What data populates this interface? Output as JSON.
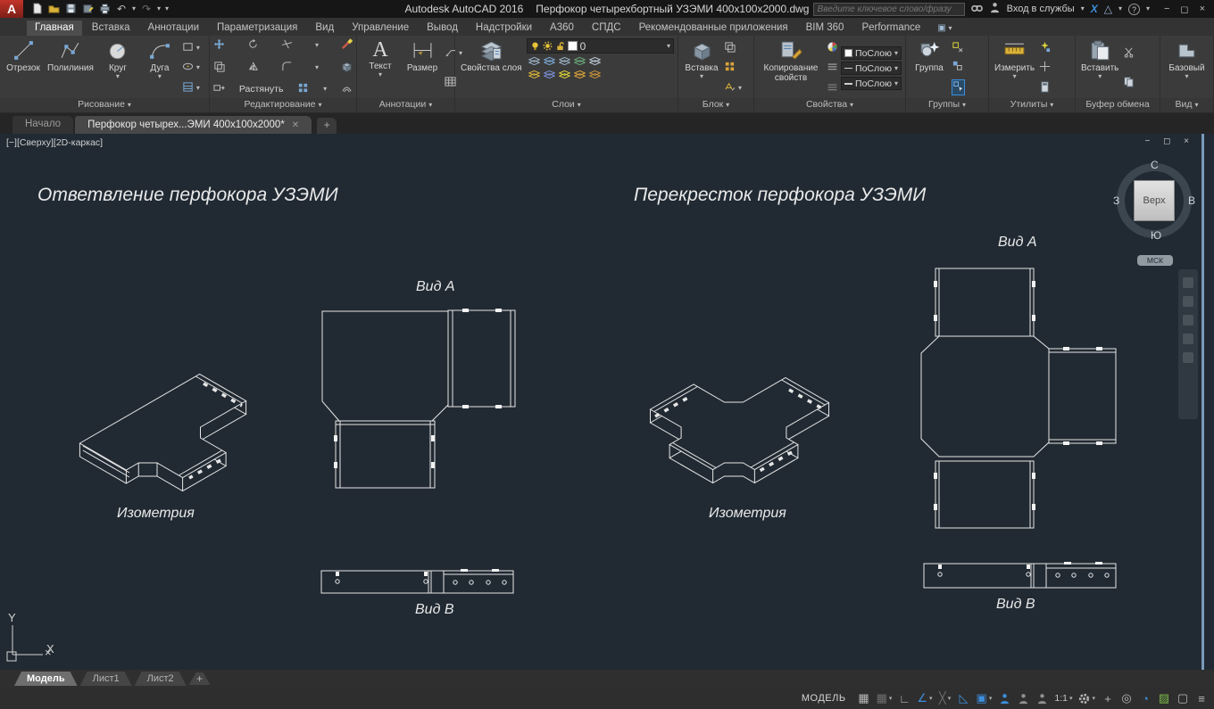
{
  "titlebar": {
    "app_title": "Autodesk AutoCAD 2016",
    "doc_title": "Перфокор четырехбортный УЗЭМИ 400x100x2000.dwg",
    "search_placeholder": "Введите ключевое слово/фразу",
    "signin_label": "Вход в службы"
  },
  "icons": {
    "caret": "▾",
    "close": "✕",
    "win_min": "−",
    "win_restore": "◻",
    "win_close": "×",
    "undo": "↶",
    "redo": "↷",
    "xlogo": "X",
    "triangle": "△",
    "help": "?",
    "grid": "▦",
    "ortho": "∟",
    "polar": "∠",
    "isodraft": "╳",
    "annot_tri": "◺",
    "annot_sq": "▣",
    "plus": "+",
    "isolate": "◎",
    "perf": "◔",
    "hw": "▨",
    "clean": "▢",
    "menu": "≡",
    "tab_cam": "▣"
  },
  "ribbon_tabs": [
    {
      "label": "Главная"
    },
    {
      "label": "Вставка"
    },
    {
      "label": "Аннотации"
    },
    {
      "label": "Параметризация"
    },
    {
      "label": "Вид"
    },
    {
      "label": "Управление"
    },
    {
      "label": "Вывод"
    },
    {
      "label": "Надстройки"
    },
    {
      "label": "A360"
    },
    {
      "label": "СПДС"
    },
    {
      "label": "Рекомендованные приложения"
    },
    {
      "label": "BIM 360"
    },
    {
      "label": "Performance"
    }
  ],
  "ribbon": {
    "draw": {
      "title": "Рисование",
      "buttons": [
        "Отрезок",
        "Полилиния",
        "Круг",
        "Дуга"
      ]
    },
    "modify": {
      "title": "Редактирование",
      "stretch_label": "Растянуть"
    },
    "annotate": {
      "title": "Аннотации",
      "text_label": "Текст",
      "dim_label": "Размер"
    },
    "layers": {
      "title": "Слои",
      "props_label": "Свойства слоя",
      "current_layer": "0"
    },
    "block": {
      "title": "Блок",
      "insert_label": "Вставка"
    },
    "properties": {
      "title": "Свойства",
      "match_label": "Копирование свойств",
      "bylayer": "ПоСлою"
    },
    "groups": {
      "title": "Группы",
      "group_label": "Группа"
    },
    "utilities": {
      "title": "Утилиты",
      "measure_label": "Измерить"
    },
    "clipboard": {
      "title": "Буфер обмена",
      "paste_label": "Вставить"
    },
    "view": {
      "title": "Вид",
      "base_label": "Базовый"
    }
  },
  "file_tabs": {
    "start": "Начало",
    "drawing": "Перфокор четырех...ЭМИ 400x100x2000*"
  },
  "viewport": {
    "controls": "[−][Сверху][2D-каркас]",
    "viewcube": {
      "n": "С",
      "e": "В",
      "s": "Ю",
      "w": "З",
      "top": "Верх",
      "wcs": "МСК"
    },
    "ucs": {
      "x": "X",
      "y": "Y"
    }
  },
  "drawings": {
    "left": {
      "title": "Ответвление перфокора УЗЭМИ",
      "view_a": "Вид А",
      "iso": "Изометрия",
      "view_b": "Вид В"
    },
    "right": {
      "title": "Перекресток перфокора УЗЭМИ",
      "view_a": "Вид А",
      "iso": "Изометрия",
      "view_b": "Вид В"
    }
  },
  "layout_tabs": {
    "model": "Модель",
    "sheet1": "Лист1",
    "sheet2": "Лист2"
  },
  "statusbar": {
    "model_label": "МОДЕЛЬ",
    "scale_label": "1:1"
  },
  "colors": {
    "accent_blue": "#3d8edb",
    "canvas_bg": "#212a33",
    "line": "#e8e8e8"
  }
}
